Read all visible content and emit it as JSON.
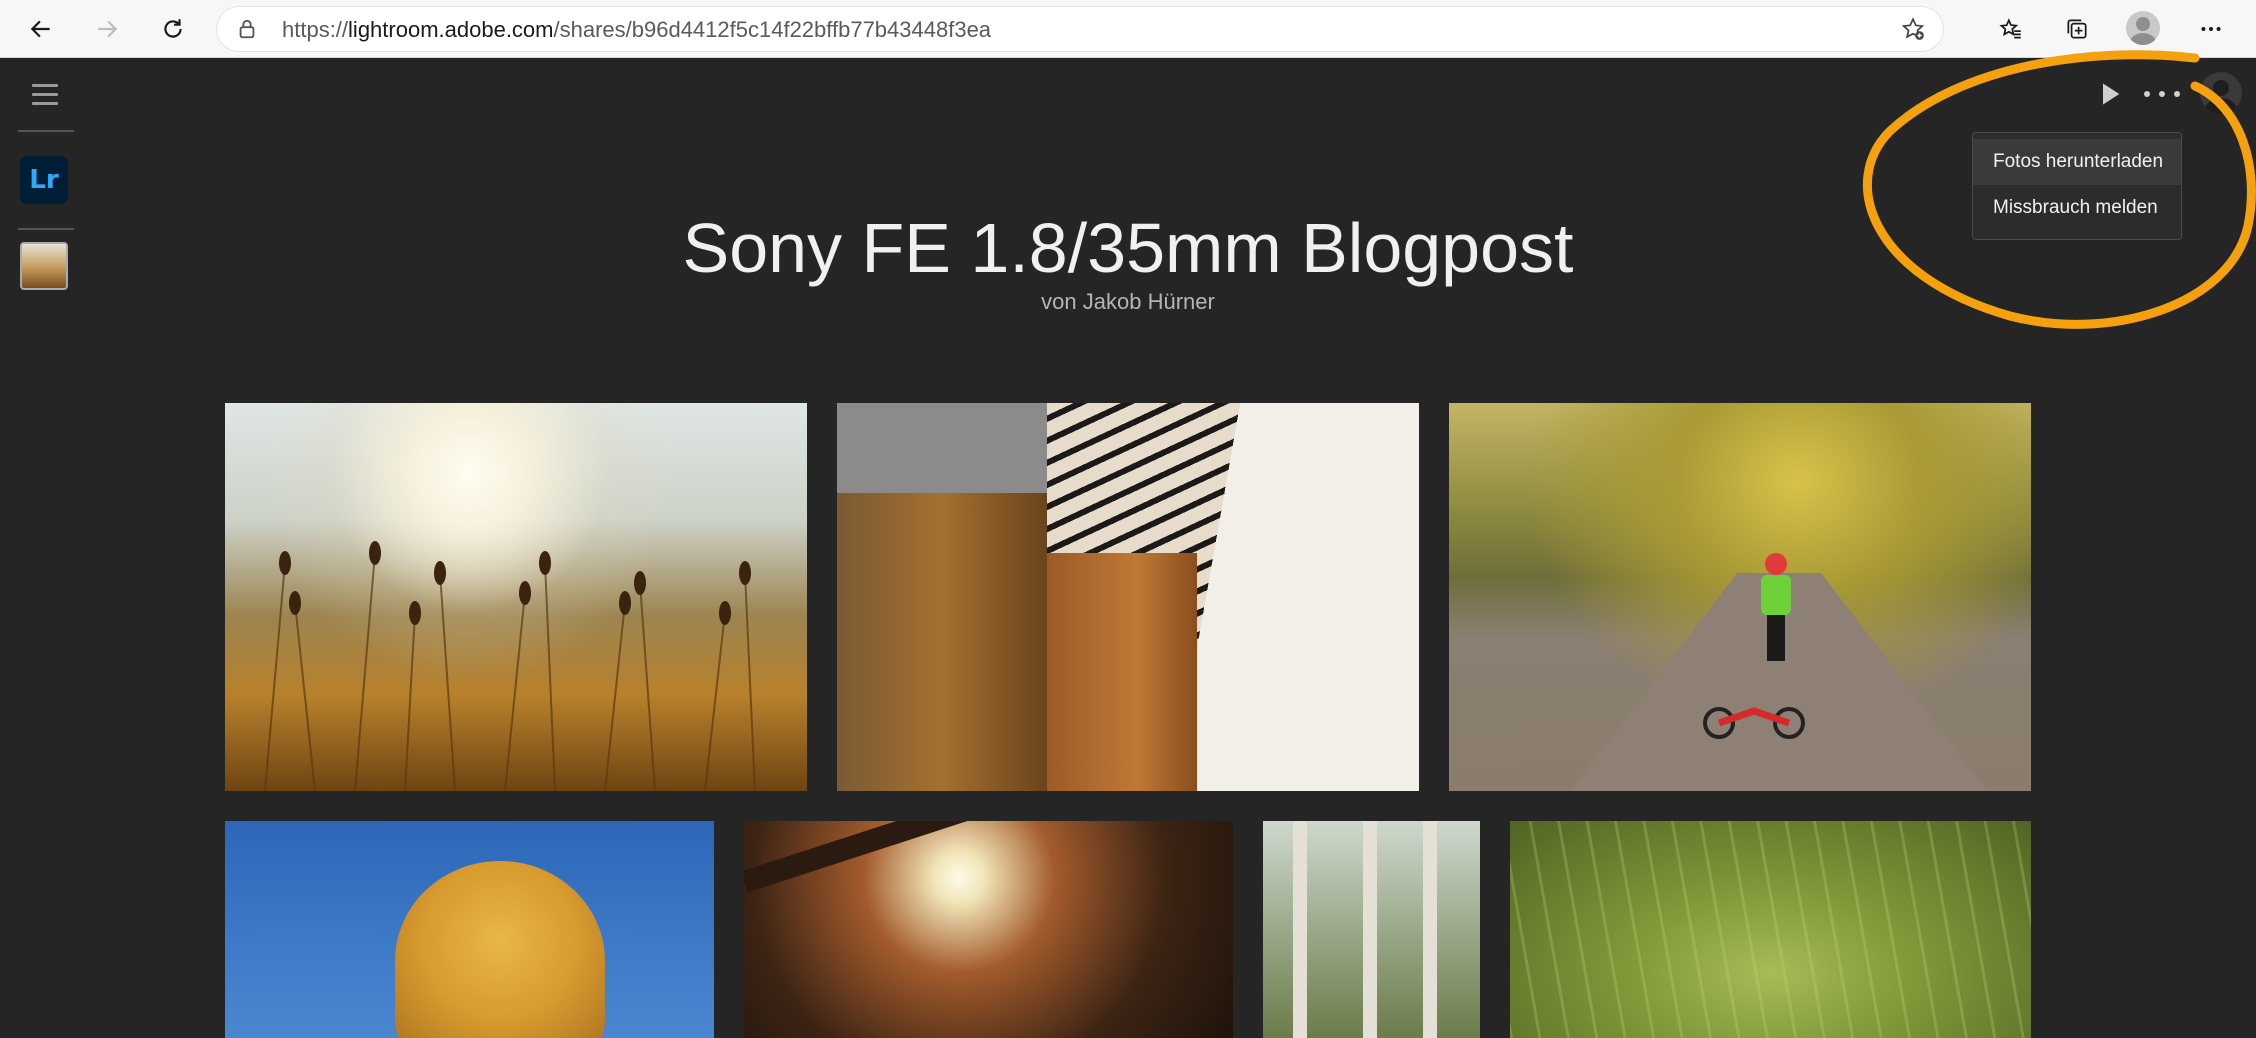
{
  "browser": {
    "url_scheme": "https://",
    "url_host": "lightroom.adobe.com",
    "url_path": "/shares/b96d4412f5c14f22bffb77b43448f3ea",
    "icons": [
      "back-arrow-icon",
      "forward-arrow-icon",
      "reload-icon",
      "lock-icon",
      "add-favorite-icon",
      "favorites-icon",
      "collections-icon",
      "profile-icon",
      "more-icon"
    ]
  },
  "rail": {
    "logo_text": "Lr",
    "logo_color": "#31a8ff"
  },
  "album": {
    "title": "Sony FE 1.8/35mm Blogpost",
    "byline": "von Jakob Hürner"
  },
  "menu": {
    "items": [
      {
        "label": "Fotos herunterladen",
        "highlighted": true
      },
      {
        "label": "Missbrauch melden",
        "highlighted": false
      }
    ]
  },
  "annotation": {
    "color": "#f5a10f"
  },
  "photos": {
    "count_visible": 7
  }
}
